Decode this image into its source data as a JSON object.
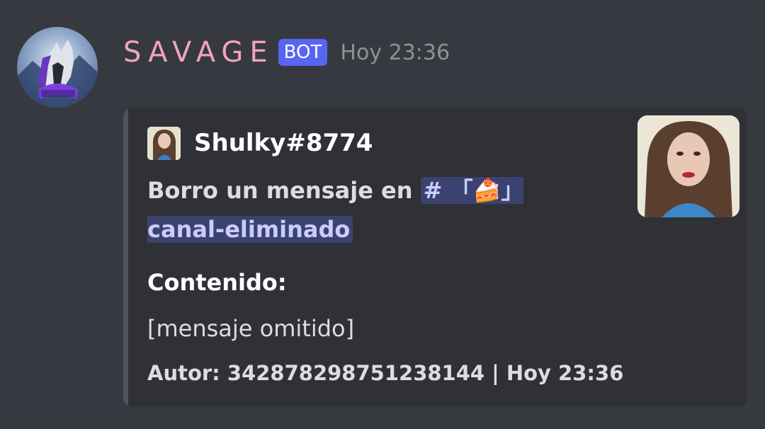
{
  "message": {
    "author": "SAVAGE",
    "bot_tag": "BOT",
    "timestamp": "Hoy 23:36"
  },
  "embed": {
    "author_name": "Shulky#8774",
    "description_prefix": "Borro un mensaje en ",
    "channel_mention": "# 「🍰」 canal-eliminado",
    "field_name": "Contenido:",
    "field_value": "[mensaje omitido]",
    "footer": "Autor: 342878298751238144 | Hoy 23:36"
  },
  "colors": {
    "background": "#36393f",
    "embed_background": "#2f3136",
    "username": "#f0a3c0",
    "bot_tag": "#5865f2",
    "mention": "#c9cdfb"
  },
  "icons": {
    "bot_avatar": "wolf-logo-avatar",
    "author_icon": "user-avatar",
    "thumbnail": "user-photo"
  }
}
